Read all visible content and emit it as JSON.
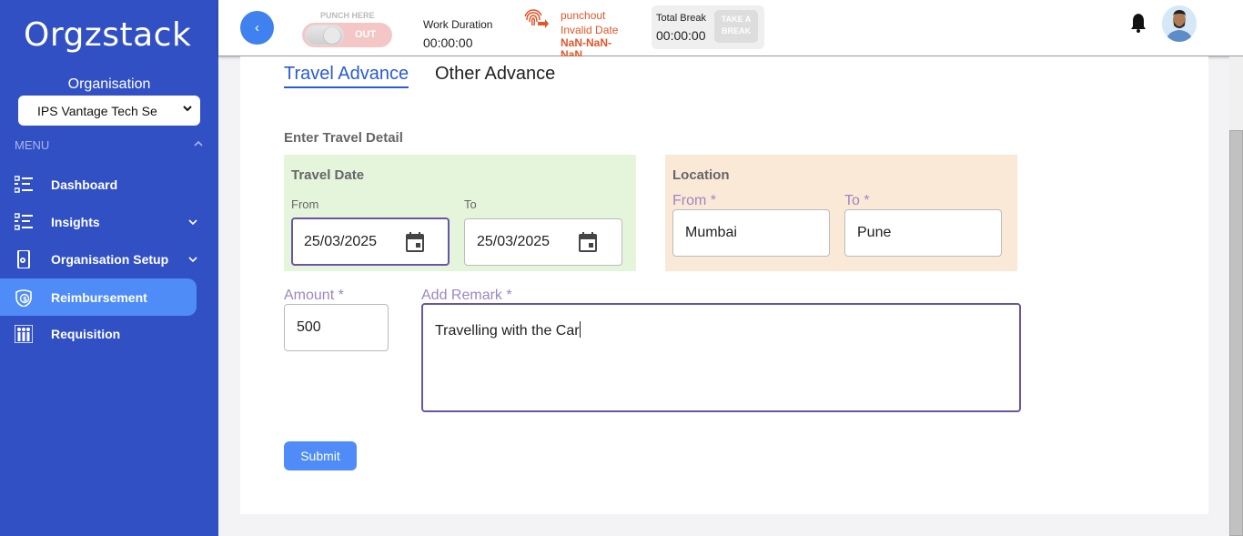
{
  "sidebar": {
    "logo": "Orgzstack",
    "org_label": "Organisation",
    "org_selected": "IPS Vantage Tech Se",
    "menu_label": "MENU",
    "items": [
      {
        "label": "Dashboard",
        "icon": "list-icon"
      },
      {
        "label": "Insights",
        "icon": "list-icon"
      },
      {
        "label": "Organisation Setup",
        "icon": "device-gear-icon"
      },
      {
        "label": "Reimbursement",
        "icon": "money-shield-icon"
      },
      {
        "label": "Requisition",
        "icon": "people-chart-icon"
      }
    ]
  },
  "topbar": {
    "back_symbol": "‹",
    "punch_label": "PUNCH HERE",
    "punch_state": "OUT",
    "work_duration_label": "Work Duration",
    "work_duration_value": "00:00:00",
    "punchout_label": "punchout",
    "punchout_date": "Invalid Date",
    "punchout_nan": "NaN-NaN-NaN",
    "total_break_label": "Total Break",
    "total_break_value": "00:00:00",
    "take_break_label": "TAKE A BREAK"
  },
  "tabs": {
    "travel": "Travel Advance",
    "other": "Other Advance"
  },
  "form": {
    "section_title": "Enter Travel Detail",
    "travel_date_title": "Travel Date",
    "from_label": "From",
    "to_label": "To",
    "from_date": "25/03/2025",
    "to_date": "25/03/2025",
    "location_title": "Location",
    "loc_from_label": "From *",
    "loc_to_label": "To *",
    "loc_from": "Mumbai",
    "loc_to": "Pune",
    "amount_label": "Amount *",
    "amount": "500",
    "remark_label": "Add Remark *",
    "remark": "Travelling with the Car",
    "submit": "Submit"
  },
  "colors": {
    "sidebar_bg": "#3150c4",
    "active_item": "#4f8cf7",
    "accent": "#2a5ad8",
    "punch_orange": "#e2562a",
    "travel_panel": "#e5f5dc",
    "location_panel": "#fbe9d8"
  }
}
